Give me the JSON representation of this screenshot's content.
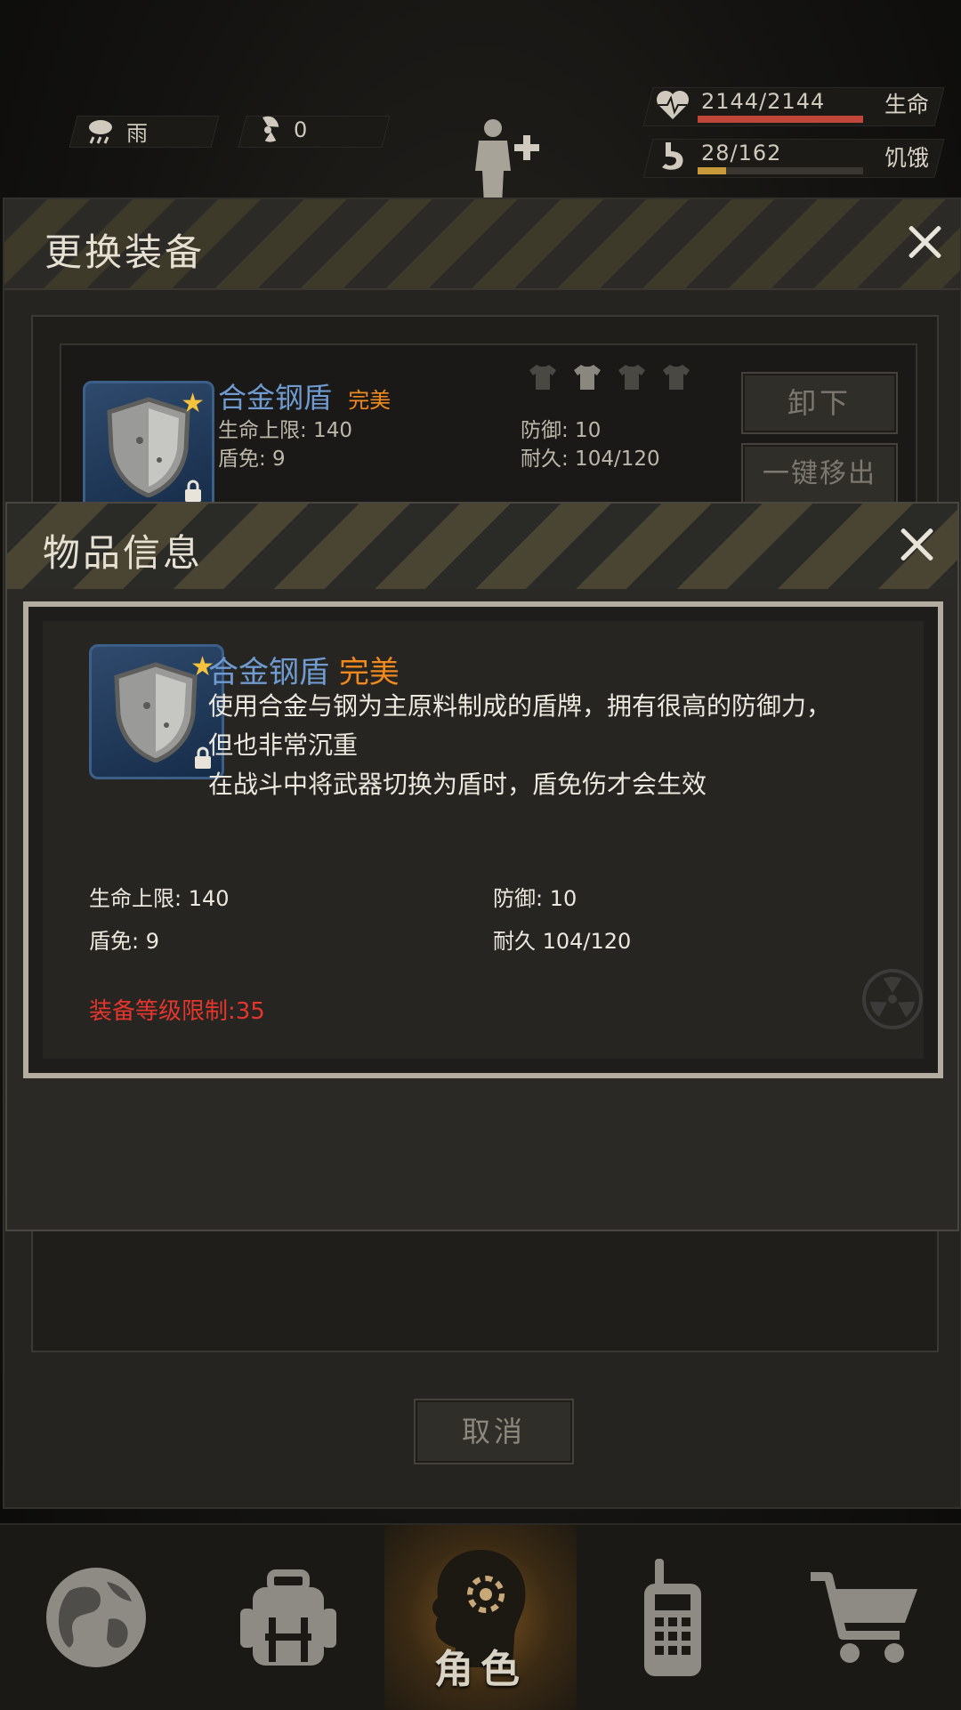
{
  "topbar": {
    "weather_label": "雨",
    "radiation_value": "0",
    "hp_text": "2144/2144",
    "hp_label": "生命",
    "hp_fraction": 1.0,
    "hunger_text": "28/162",
    "hunger_label": "饥饿",
    "hunger_fraction": 0.17
  },
  "change_equipment": {
    "title": "更换装备",
    "item": {
      "name": "合金钢盾",
      "quality": "完美",
      "stat_left_1": "生命上限: 140",
      "stat_left_2": "盾免: 9",
      "stat_right_1": "防御: 10",
      "stat_right_2": "耐久: 104/120"
    },
    "unequip_label": "卸下",
    "remove_all_label": "一键移出",
    "cancel_label": "取消"
  },
  "item_info": {
    "title": "物品信息",
    "name": "合金钢盾",
    "quality": "完美",
    "desc_line1": "使用合金与钢为主原料制成的盾牌，拥有很高的防御力，",
    "desc_line2": "但也非常沉重",
    "desc_line3": "在战斗中将武器切换为盾时，盾免伤才会生效",
    "stat_hp": "生命上限: 140",
    "stat_defense": "防御: 10",
    "stat_block": "盾免: 9",
    "stat_durability": "耐久 104/120",
    "level_requirement": "装备等级限制:35"
  },
  "nav": {
    "active_label": "角色"
  },
  "colors": {
    "name_blue": "#6f9bd1",
    "quality_orange": "#f0891e",
    "requirement_red": "#e4362c",
    "hp_bar": "#c0463a",
    "hunger_bar": "#c89a3a"
  }
}
